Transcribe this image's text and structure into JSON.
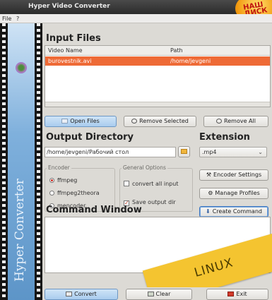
{
  "window": {
    "title": "Hyper Video Converter"
  },
  "badge": {
    "line1": "НАШ",
    "line2": "ДИСК"
  },
  "menu": {
    "file": "File",
    "help": "?"
  },
  "sidebar": {
    "label": "Hyper Converter"
  },
  "input_files": {
    "heading": "Input Files",
    "columns": [
      "Video Name",
      "Path"
    ],
    "rows": [
      {
        "name": "burovestnik.avi",
        "path": "/home/jevgeni"
      }
    ]
  },
  "file_buttons": {
    "open": "Open Files",
    "remove_selected": "Remove Selected",
    "remove_all": "Remove All"
  },
  "output": {
    "heading": "Output Directory",
    "path": "/home/jevgeni/Рабочий стол"
  },
  "extension": {
    "heading": "Extension",
    "value": ".mp4"
  },
  "encoder": {
    "label": "Encoder",
    "options": [
      "ffmpeg",
      "ffmpeg2theora",
      "mencoder"
    ],
    "selected": "ffmpeg"
  },
  "general_options": {
    "label": "General Options",
    "convert_all": "convert all input",
    "save_output": "Save output dir",
    "convert_all_checked": false,
    "save_output_checked": true
  },
  "side_buttons": {
    "encoder_settings": "Encoder Settings",
    "manage_profiles": "Manage Profiles",
    "create_command": "Create Command"
  },
  "command_window": {
    "heading": "Command Window",
    "text": ""
  },
  "bottom_buttons": {
    "convert": "Convert",
    "clear": "Clear",
    "exit": "Exit"
  },
  "overlay": {
    "sticker": "LINUX"
  },
  "colors": {
    "selection": "#ee6a36",
    "sticker": "#f4c430",
    "accent": "#3f77c0"
  }
}
